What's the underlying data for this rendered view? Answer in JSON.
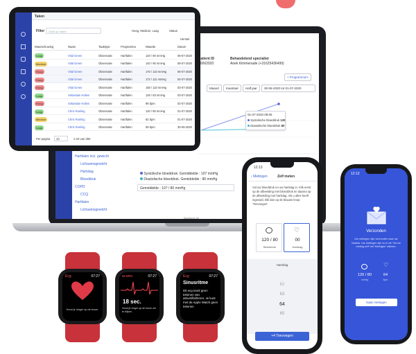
{
  "colors": {
    "brand_blue": "#2b43a8",
    "link_blue": "#3b63d6",
    "watch_red": "#c8323a",
    "accent_red": "#ef6d6d"
  },
  "tablet": {
    "title": "Taken",
    "filter_label": "Filter",
    "search_placeholder": "Zoek op naam",
    "filter_values": "Hoog, Medium, Laag",
    "status_label": "Status",
    "reset_label": "Herstel",
    "columns": [
      "Waarschuwing",
      "Naam",
      "Taaktype",
      "Programma",
      "Waarde",
      "Datum"
    ],
    "rows": [
      {
        "level": "Laag",
        "color": "#8fd98a",
        "name": "Vital Green",
        "type": "Observatie",
        "program": "Hartfalen",
        "value": "120 / 80 mmHg",
        "date": "09-07-2020"
      },
      {
        "level": "Medium",
        "color": "#f3d36b",
        "name": "Vital Green",
        "type": "Observatie",
        "program": "Hartfalen",
        "value": "140 / 90 mmHg",
        "date": "08-07-2020"
      },
      {
        "level": "Hoog",
        "color": "#f08a8a",
        "name": "Vital Green",
        "type": "Observatie",
        "program": "Hartfalen",
        "value": "170 / 110 mmHg",
        "date": "06-07-2020"
      },
      {
        "level": "Hoog",
        "color": "#f08a8a",
        "name": "Vital Green",
        "type": "Observatie",
        "program": "Hartfalen",
        "value": "172 / 111 mmHg",
        "date": "04-07-2020"
      },
      {
        "level": "Hoog",
        "color": "#f08a8a",
        "name": "Vital Green",
        "type": "Observatie",
        "program": "Hartfalen",
        "value": "168 / 110 mmHg",
        "date": "03-07-2020"
      },
      {
        "level": "Laag",
        "color": "#8fd98a",
        "name": "Sebastian Holtes",
        "type": "Observatie",
        "program": "Hartfalen",
        "value": "126 / 83 mmHg",
        "date": "03-07-2020"
      },
      {
        "level": "Hoog",
        "color": "#f08a8a",
        "name": "Sebastian Holtes",
        "type": "Observatie",
        "program": "Hartfalen",
        "value": "98 bpm",
        "date": "02-07-2020"
      },
      {
        "level": "Laag",
        "color": "#8fd98a",
        "name": "Chris Roeling",
        "type": "Observatie",
        "program": "Hartfalen",
        "value": "120 / 80 mmHg",
        "date": "01-07-2020"
      },
      {
        "level": "Medium",
        "color": "#f3d36b",
        "name": "Chris Roeling",
        "type": "Observatie",
        "program": "Hartfalen",
        "value": "82 bpm",
        "date": "01-07-2020"
      },
      {
        "level": "Laag",
        "color": "#8fd98a",
        "name": "Chris Roeling",
        "type": "Observatie",
        "program": "Hartfalen",
        "value": "59 bpm",
        "date": "30-06-2020"
      }
    ],
    "per_page_label": "Per pagina",
    "per_page_value": "10",
    "page_info": "1-10 van 250"
  },
  "laptop": {
    "patient_label": "Patient ID",
    "patient_value": "30062020",
    "specialist_label": "Behandelend specialist",
    "specialist_value": "Anek Kimmenade (+31625436499)",
    "program_button": "+ Programma's",
    "range_buttons": [
      "Maand",
      "Kwartaal",
      "Half jaar"
    ],
    "date_range": "30-06-2020 tot 01-07-2020",
    "tooltip_date": "01-07-2020 09:05",
    "tooltip_sys_label": "Systolische bloeddruk",
    "tooltip_sys_value": "120",
    "tooltip_dia_label": "Diastolische bloeddruk",
    "tooltip_dia_value": "80",
    "tree": [
      "Hartfalen incl. gewicht",
      "Lichaamsgewicht",
      "Hartslag",
      "Bloeddruk",
      "COPD",
      "CCQ",
      "Hartfalen",
      "Lichaamsgewicht"
    ],
    "legend_sys": "Systolische bloeddruk. Gemiddelde : 107 mmHg",
    "legend_dia": "Diastolische bloeddruk. Gemiddelde : 80 mmHg",
    "average": "Gemiddelde : 107 / 80 mmHg",
    "brand": "MacBook Air"
  },
  "phone1": {
    "time": "12:13",
    "back": "Metingen",
    "title": "Zelf meten",
    "instruction": "Vul uw bloeddruk en uw hartslag in. Klik eerst op de afbeelding met bloeddruk en daarna op de afbeelding met hartslag. Als u alles heeft ingevuld, klik dan op de blauwe knop 'Toevoegen'",
    "bp_value": "120 / 80",
    "bp_label": "Bloeddruk",
    "hr_value": "00",
    "hr_label": "Hartslag",
    "picker_label": "Hartslag",
    "picker_values": [
      "62",
      "63",
      "64",
      "65"
    ],
    "submit": "+4 Toevoegen"
  },
  "phone2": {
    "time": "12:13",
    "title": "Verzonden",
    "message": "Uw metingen zijn verzonden naar uw Notaris. Uw metingen zijn nu in de 'Vul uw meting zelf' het 'Metingen' uitleren.",
    "bp_value": "120 / 80",
    "bp_unit": "mmHg",
    "hr_value": "64",
    "hr_unit": "bpm",
    "button": "Naar metingen"
  },
  "watches": [
    {
      "time": "07:27",
      "app": "Ecg",
      "text": "Houd je vinger op de kroon."
    },
    {
      "time": "07:27",
      "bpm": "58 BPM",
      "seconds": "18 sec.",
      "text": "Houd je vinger op de kroon om te blijven."
    },
    {
      "time": "07:27",
      "app": "Ecg",
      "title": "Sinusritme",
      "text": "Dit ecg toont geen tekenen van atriumfibrilleren. Je kunt met de Apple Watch geen tekenen"
    }
  ]
}
